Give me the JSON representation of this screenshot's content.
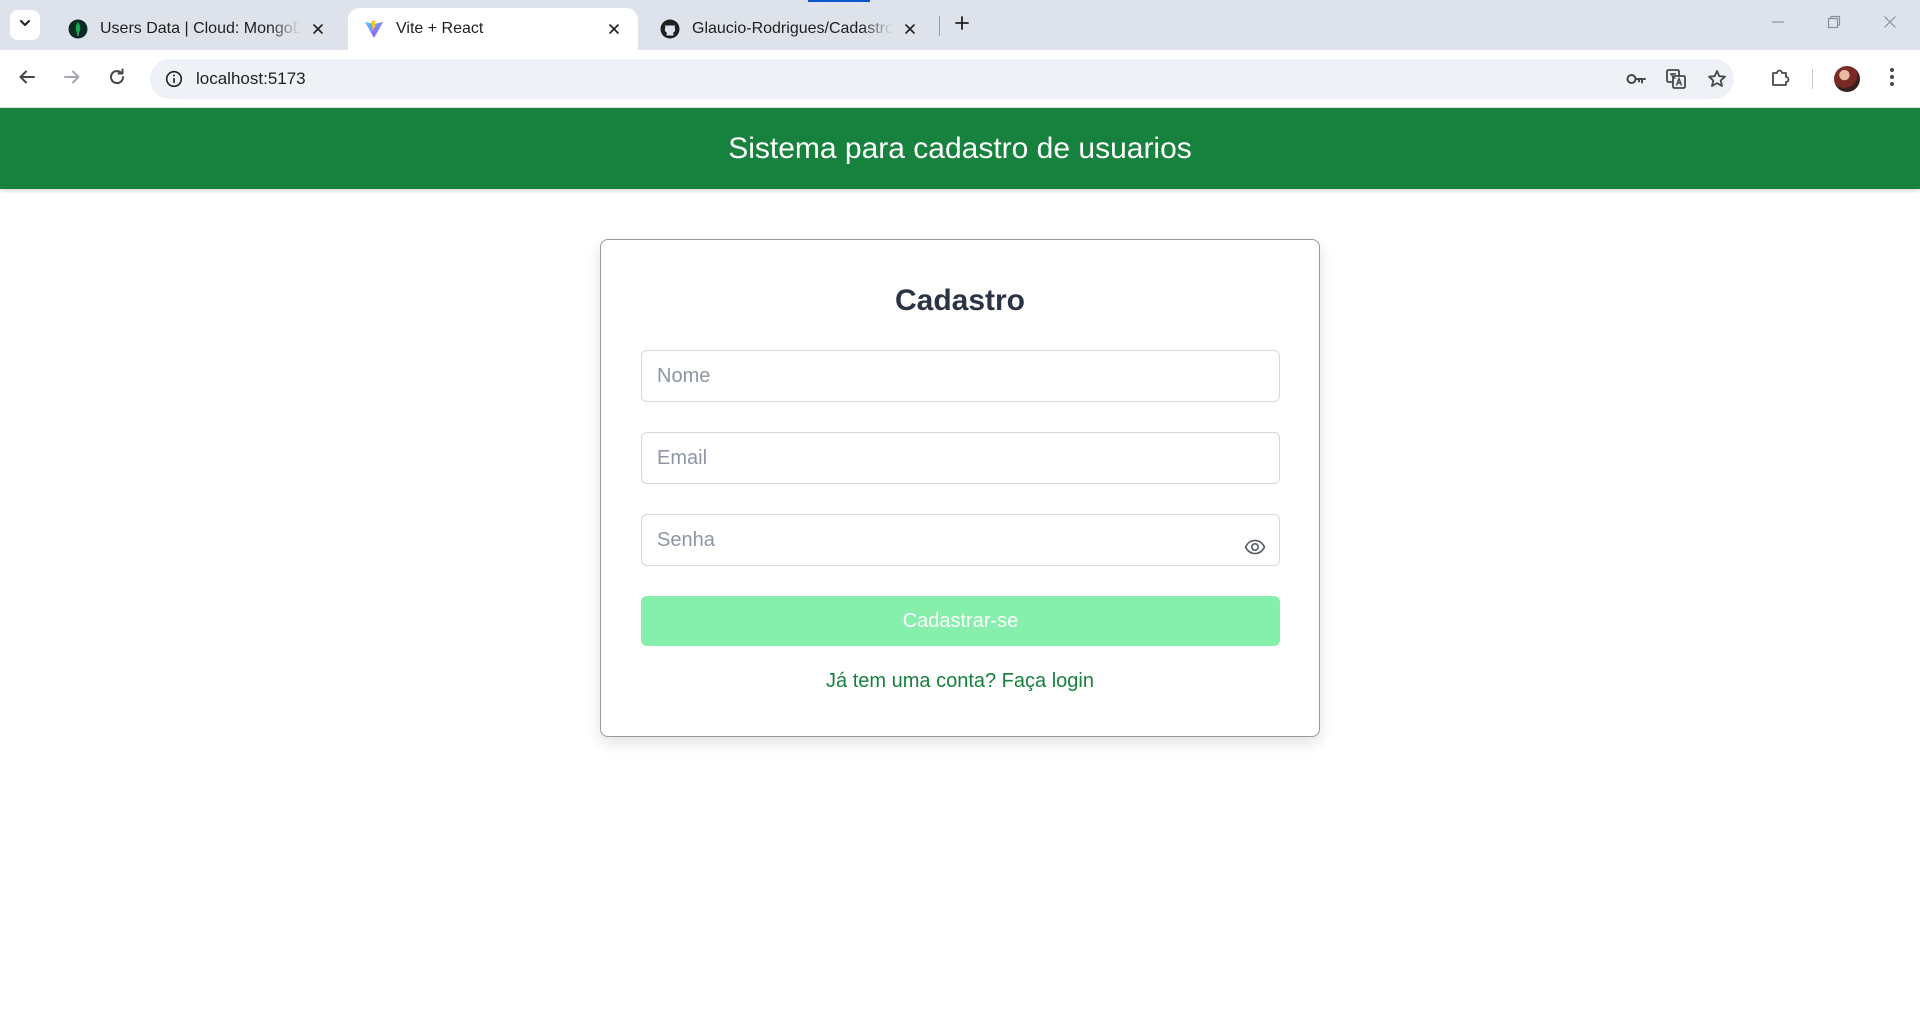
{
  "browser": {
    "tabs": [
      {
        "title": "Users Data | Cloud: MongoDB Cloud",
        "favicon": "mongodb-leaf-icon",
        "active": false
      },
      {
        "title": "Vite + React",
        "favicon": "vite-icon",
        "active": true
      },
      {
        "title": "Glaucio-Rodrigues/Cadastro-de-usuarios",
        "favicon": "github-icon",
        "active": false
      }
    ],
    "address": "localhost:5173"
  },
  "header": {
    "title": "Sistema para cadastro de usuarios"
  },
  "form": {
    "title": "Cadastro",
    "name_placeholder": "Nome",
    "email_placeholder": "Email",
    "password_placeholder": "Senha",
    "submit_label": "Cadastrar-se",
    "login_link": "Já tem uma conta? Faça login"
  },
  "colors": {
    "header_bg": "#17823d",
    "submit_bg": "#86efac",
    "link": "#16803c",
    "title_text": "#2b3445"
  }
}
